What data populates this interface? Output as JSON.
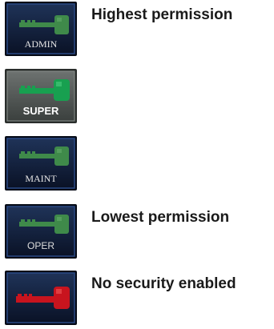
{
  "levels": [
    {
      "key_label": "ADMIN",
      "description": "Highest permission",
      "state": "default",
      "key_color": "#3f8a4a",
      "icon": "key-icon"
    },
    {
      "key_label": "SUPER",
      "description": "",
      "state": "active",
      "key_color": "#18a050",
      "icon": "key-icon"
    },
    {
      "key_label": "MAINT",
      "description": "",
      "state": "default",
      "key_color": "#3f8a4a",
      "icon": "key-icon"
    },
    {
      "key_label": "OPER",
      "description": "Lowest permission",
      "state": "default",
      "key_color": "#3f8a4a",
      "icon": "key-icon"
    },
    {
      "key_label": "",
      "description": "No security enabled",
      "state": "default",
      "key_color": "#c8141e",
      "icon": "key-icon"
    }
  ]
}
